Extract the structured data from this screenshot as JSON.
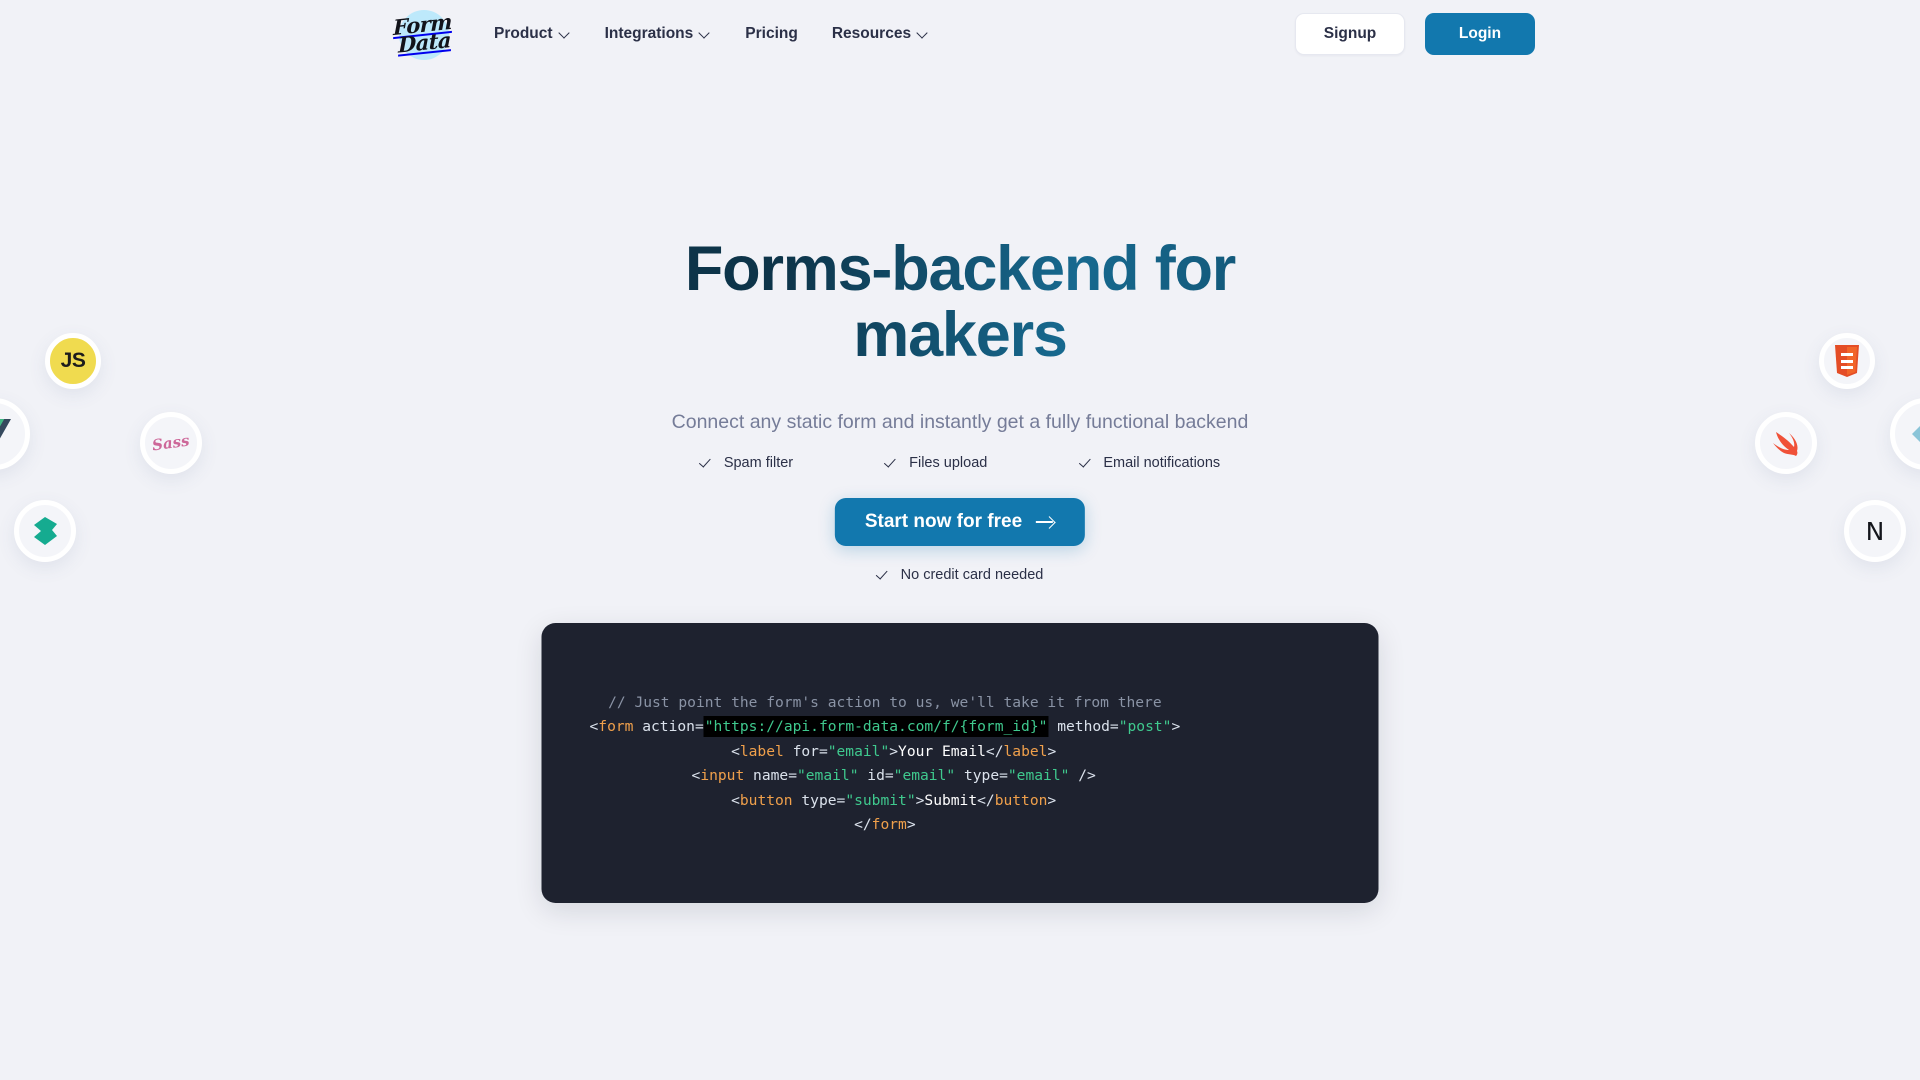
{
  "brand": {
    "logo_line1": "Form",
    "logo_line2": "Data",
    "logo_icon": "formdata-script-logo"
  },
  "header": {
    "nav": [
      {
        "label": "Product",
        "has_dropdown": true
      },
      {
        "label": "Integrations",
        "has_dropdown": true
      },
      {
        "label": "Pricing",
        "has_dropdown": false
      },
      {
        "label": "Resources",
        "has_dropdown": true
      }
    ],
    "signup_label": "Signup",
    "login_label": "Login"
  },
  "hero": {
    "title_line1": "Forms-backend for",
    "title_line2": "makers",
    "subtitle": "Connect any static form and instantly get a fully functional backend",
    "features": [
      "Spam filter",
      "Files upload",
      "Email notifications"
    ],
    "cta_label": "Start now for free",
    "cta_icon": "arrow-right-icon",
    "no_card_label": "No credit card needed"
  },
  "code": {
    "comment": "// Just point the form's action to us, we'll take it from there",
    "line2": {
      "open": "<",
      "tag": "form",
      "attr1": " action=",
      "url": "\"https://api.form-data.com/f/{form_id}\"",
      "attr2": " method=",
      "method": "\"post\"",
      "close": ">"
    },
    "line3": {
      "indent": "  ",
      "open": "<",
      "tag": "label",
      "attr": " for=",
      "val": "\"email\"",
      "gt": ">",
      "text": "Your Email",
      "closeopen": "</",
      "closetag": "label",
      "closegt": ">"
    },
    "line4": {
      "indent": "  ",
      "open": "<",
      "tag": "input",
      "a1": " name=",
      "v1": "\"email\"",
      "a2": " id=",
      "v2": "\"email\"",
      "a3": " type=",
      "v3": "\"email\"",
      "end": " />"
    },
    "line5": {
      "indent": "  ",
      "open": "<",
      "tag": "button",
      "attr": " type=",
      "val": "\"submit\"",
      "gt": ">",
      "text": "Submit",
      "closeopen": "</",
      "closetag": "button",
      "closegt": ">"
    },
    "line6": {
      "open": "</",
      "tag": "form",
      "gt": ">"
    }
  },
  "tech_logos": [
    {
      "name": "javascript",
      "label": "JS",
      "color": "#f0db4f"
    },
    {
      "name": "vue",
      "label": "",
      "color": "#41b883"
    },
    {
      "name": "sass",
      "label": "Sass",
      "color": "#cd6799"
    },
    {
      "name": "gatsby",
      "label": "",
      "color": "#15ab90"
    },
    {
      "name": "html5",
      "label": "5",
      "color": "#e44d26"
    },
    {
      "name": "swift",
      "label": "",
      "color": "#f05138"
    },
    {
      "name": "hugo",
      "label": "",
      "color": "#8ac4d8"
    },
    {
      "name": "nuxt",
      "label": "N",
      "color": "#14161c"
    }
  ],
  "colors": {
    "page_bg": "#f1f2f7",
    "accent": "#1278ae",
    "heading_dark": "#0d3449",
    "heading_light": "#17698f",
    "code_bg": "#1e222f",
    "muted_text": "#757c98"
  }
}
